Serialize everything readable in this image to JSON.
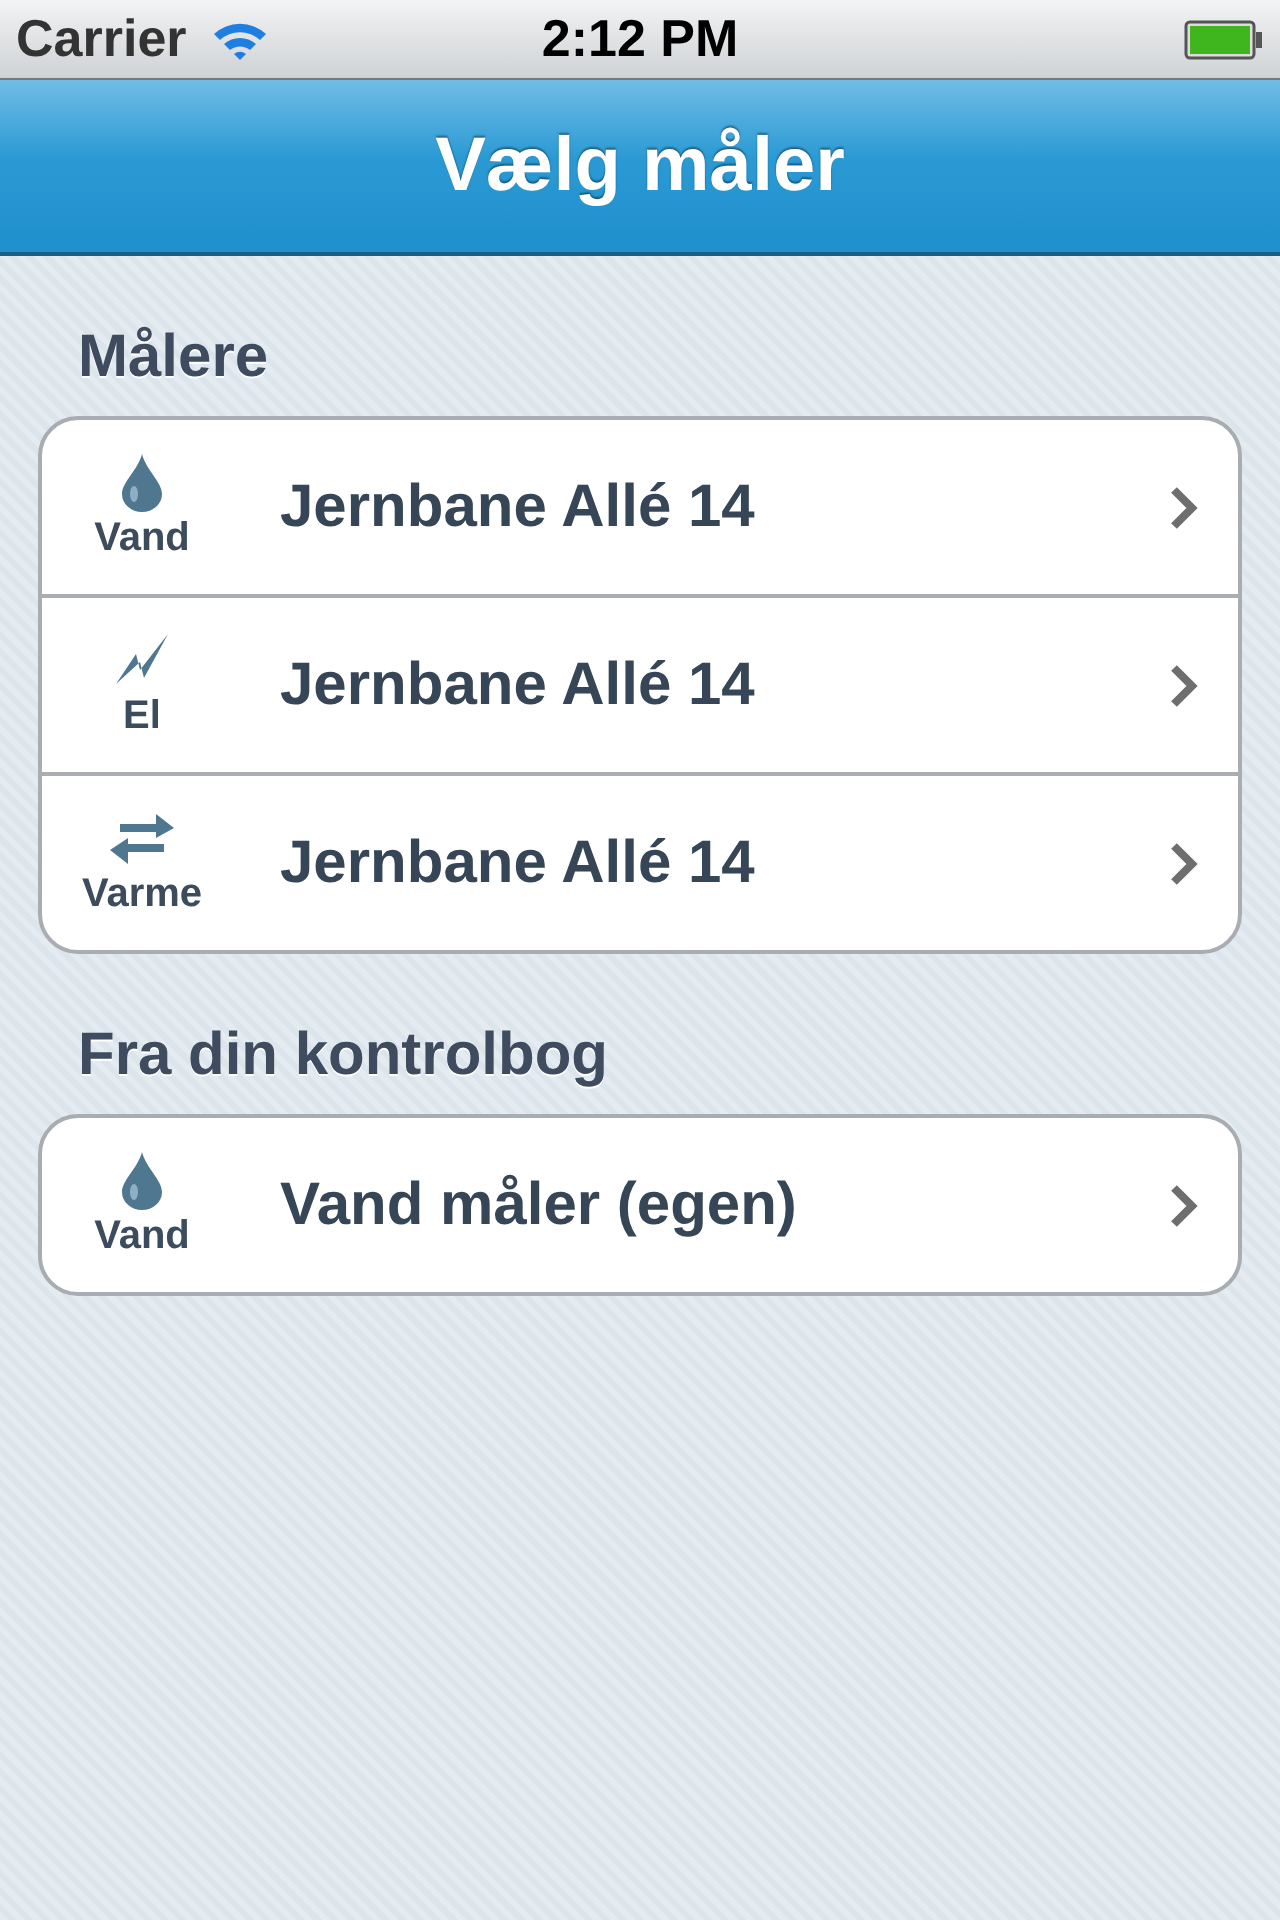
{
  "status_bar": {
    "carrier": "Carrier",
    "time": "2:12 PM"
  },
  "nav_bar": {
    "title": "Vælg måler"
  },
  "sections": [
    {
      "header": "Målere",
      "rows": [
        {
          "kind": "water",
          "type_label": "Vand",
          "title": "Jernbane Allé 14"
        },
        {
          "kind": "electric",
          "type_label": "El",
          "title": "Jernbane Allé 14"
        },
        {
          "kind": "heat",
          "type_label": "Varme",
          "title": "Jernbane Allé 14"
        }
      ]
    },
    {
      "header": "Fra din kontrolbog",
      "rows": [
        {
          "kind": "water",
          "type_label": "Vand",
          "title": "Vand måler (egen)"
        }
      ]
    }
  ]
}
